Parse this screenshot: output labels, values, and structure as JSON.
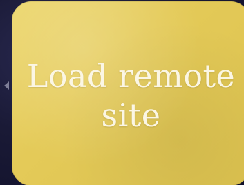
{
  "card": {
    "label": "Load remote site",
    "background_color": "#e4ca58",
    "text_color": "#fbf6e4"
  },
  "nav": {
    "left_icon": "chevron-left-icon"
  }
}
